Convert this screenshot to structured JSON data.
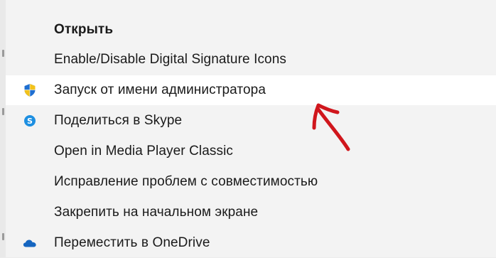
{
  "context_menu": {
    "items": [
      {
        "label": "Открыть",
        "bold": true,
        "icon": ""
      },
      {
        "label": "Enable/Disable Digital Signature Icons",
        "bold": false,
        "icon": ""
      },
      {
        "label": "Запуск от имени администратора",
        "bold": false,
        "icon": "uac-shield-icon",
        "highlighted": true
      },
      {
        "label": "Поделиться в Skype",
        "bold": false,
        "icon": "skype-icon"
      },
      {
        "label": "Open in Media Player Classic",
        "bold": false,
        "icon": ""
      },
      {
        "label": "Исправление проблем с совместимостью",
        "bold": false,
        "icon": ""
      },
      {
        "label": "Закрепить на начальном экране",
        "bold": false,
        "icon": ""
      },
      {
        "label": "Переместить в OneDrive",
        "bold": false,
        "icon": "onedrive-icon"
      }
    ]
  },
  "annotation": {
    "arrow_color": "#d0161c"
  },
  "colors": {
    "menu_background": "#f3f3f3",
    "highlight_background": "#ffffff",
    "text": "#1a1a1a",
    "shield_blue": "#1f6fd1",
    "shield_yellow": "#f3c21a",
    "skype_blue": "#1d8fe1",
    "onedrive_blue": "#1565c0"
  }
}
